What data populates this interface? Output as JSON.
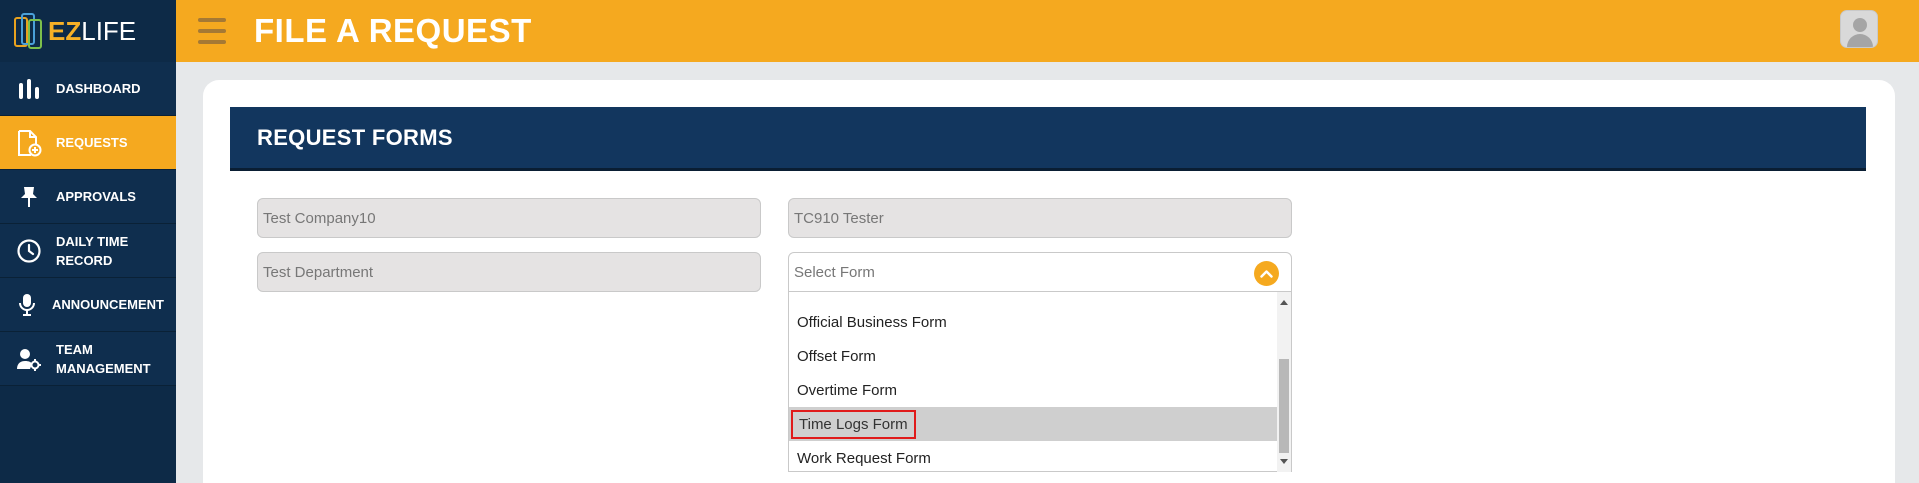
{
  "sidebar": {
    "logo": {
      "ez": "EZ",
      "life": "LIFE"
    },
    "items": [
      {
        "label": "DASHBOARD",
        "icon": "bar-chart-icon"
      },
      {
        "label": "REQUESTS",
        "icon": "document-plus-icon",
        "active": true
      },
      {
        "label": "APPROVALS",
        "icon": "pin-icon"
      },
      {
        "label": "DAILY TIME RECORD",
        "icon": "clock-icon"
      },
      {
        "label": "ANNOUNCEMENT",
        "icon": "microphone-icon"
      },
      {
        "label": "TEAM MANAGEMENT",
        "icon": "user-gear-icon"
      }
    ]
  },
  "header": {
    "title": "FILE A REQUEST",
    "accent": "#f5a91f"
  },
  "form": {
    "section_title": "REQUEST FORMS",
    "company": "Test Company10",
    "employee": "TC910 Tester",
    "department": "Test Department",
    "select_placeholder": "Select Form",
    "options": [
      "Official Business Form",
      "Offset Form",
      "Overtime Form",
      "Time Logs Form",
      "Work Request Form"
    ],
    "highlighted_option": "Time Logs Form"
  },
  "colors": {
    "sidebar_bg": "#0d2a47",
    "section_bar": "#12365e",
    "highlight_border": "#e01a1a"
  }
}
